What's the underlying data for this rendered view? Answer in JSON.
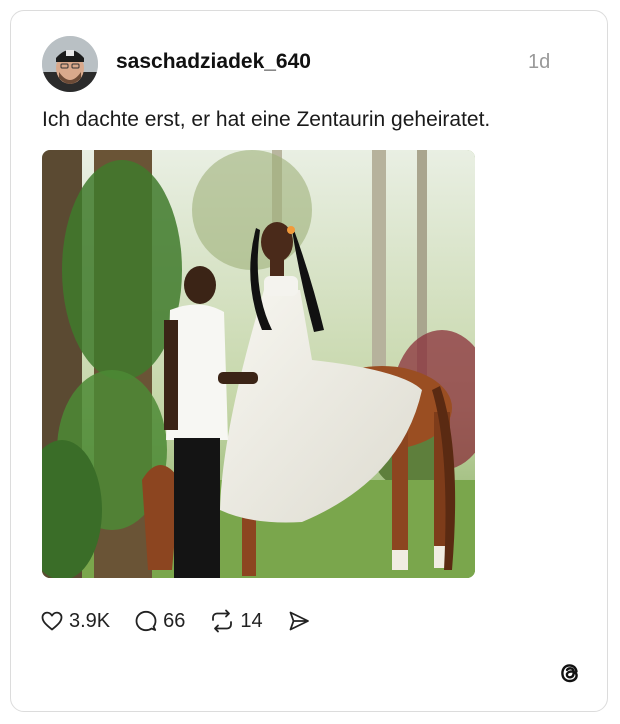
{
  "post": {
    "username": "saschadziadek_640",
    "time": "1d",
    "text": "Ich dachte erst, er hat eine Zentaurin geheiratet.",
    "image_description": "Photo of a couple in a tropical garden; the woman in a long white dress appears to have a horse's body",
    "likes": "3.9K",
    "comments": "66",
    "reposts": "14"
  },
  "icons": {
    "like": "heart-icon",
    "comment": "comment-bubble-icon",
    "repost": "repost-icon",
    "share": "send-icon",
    "brand": "threads-logo-icon"
  },
  "colors": {
    "border": "#dcdcdc",
    "muted": "#999999",
    "text": "#111111"
  }
}
